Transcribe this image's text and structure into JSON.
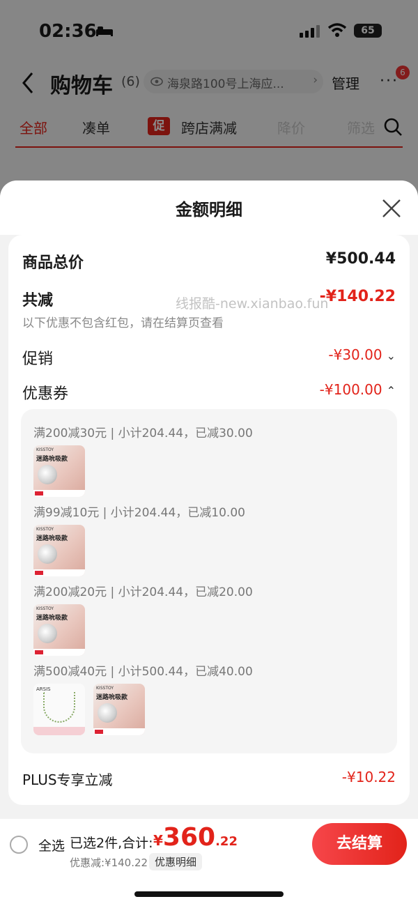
{
  "status_bar": {
    "time": "02:36",
    "battery": "65"
  },
  "nav": {
    "title": "购物车",
    "count": "(6)",
    "address": "海泉路100号上海应...",
    "address_chevron": "›",
    "manage": "管理",
    "more": "···",
    "badge": "6"
  },
  "tabs": {
    "all": "全部",
    "bundle": "凑单",
    "promo_tag": "促",
    "cross_store": "跨店满减",
    "price_drop": "降价",
    "filter": "筛选"
  },
  "sheet": {
    "title": "金额明细",
    "total_label": "商品总价",
    "total_value": "¥500.44",
    "reduce_label": "共减",
    "reduce_value": "-¥140.22",
    "reduce_note": "以下优惠不包含红包，请在结算页查看",
    "watermark": "线报酷-new.xianbao.fun",
    "promo_label": "促销",
    "promo_value": "-¥30.00",
    "promo_chevron": "⌄",
    "coupon_label": "优惠券",
    "coupon_value": "-¥100.00",
    "coupon_chevron": "⌃",
    "coupons": [
      {
        "text": "满200减30元 | 小计204.44，已减30.00"
      },
      {
        "text": "满99减10元 | 小计204.44，已减10.00"
      },
      {
        "text": "满200减20元 | 小计204.44，已减20.00"
      },
      {
        "text": "满500减40元 | 小计500.44，已减40.00"
      }
    ],
    "product_thumb": {
      "brand": "KISSTOY",
      "name": "迷路吮吸款"
    },
    "necklace_thumb": {
      "brand": "ARSIS"
    },
    "plus_label": "PLUS专享立减",
    "plus_value": "-¥10.22"
  },
  "bottom_bar": {
    "select_all": "全选",
    "selected": "已选2件,合计:",
    "currency": "¥",
    "total_int": "360",
    "total_dec": ".22",
    "discount": "优惠减:¥140.22",
    "detail": "优惠明细",
    "checkout": "去结算"
  }
}
